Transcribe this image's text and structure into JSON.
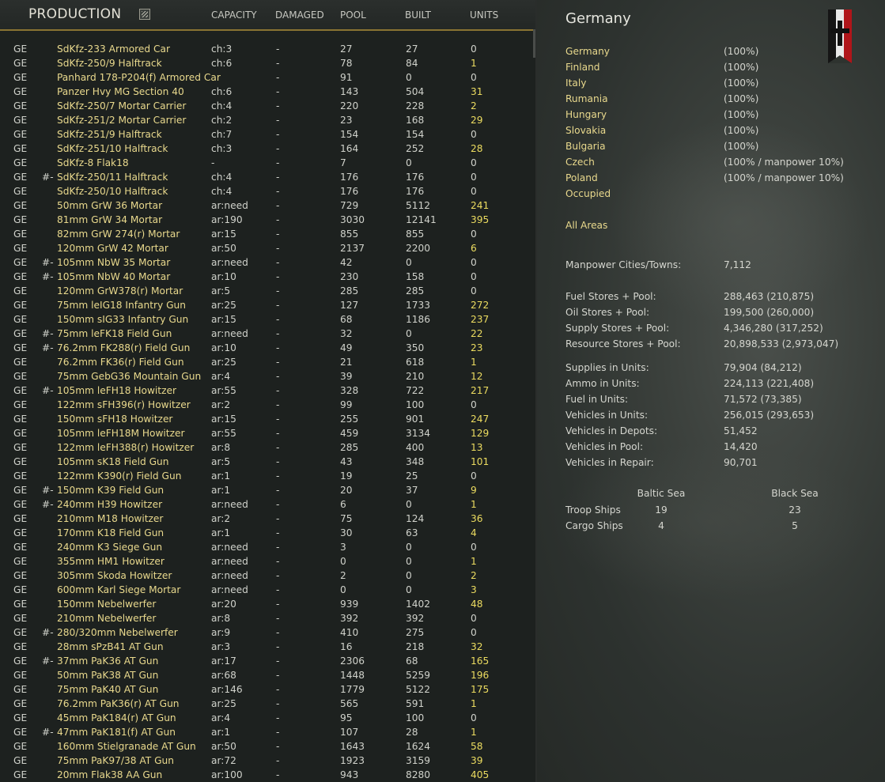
{
  "production": {
    "title": "PRODUCTION",
    "columns": [
      "CAPACITY",
      "DAMAGED",
      "POOL",
      "BUILT",
      "UNITS"
    ],
    "rows": [
      {
        "nat": "GE",
        "mark": "",
        "name": "SdKfz-233 Armored Car",
        "cap": "ch:3",
        "dmg": "-",
        "pool": "27",
        "built": "27",
        "units": "0"
      },
      {
        "nat": "GE",
        "mark": "",
        "name": "SdKfz-250/9 Halftrack",
        "cap": "ch:6",
        "dmg": "-",
        "pool": "78",
        "built": "84",
        "units": "1"
      },
      {
        "nat": "GE",
        "mark": "",
        "name": "Panhard 178-P204(f) Armored Car",
        "cap": "",
        "dmg": "-",
        "pool": "91",
        "built": "0",
        "units": "0"
      },
      {
        "nat": "GE",
        "mark": "",
        "name": "Panzer Hvy MG Section 40",
        "cap": "ch:6",
        "dmg": "-",
        "pool": "143",
        "built": "504",
        "units": "31"
      },
      {
        "nat": "GE",
        "mark": "",
        "name": "SdKfz-250/7 Mortar Carrier",
        "cap": "ch:4",
        "dmg": "-",
        "pool": "220",
        "built": "228",
        "units": "2"
      },
      {
        "nat": "GE",
        "mark": "",
        "name": "SdKfz-251/2 Mortar Carrier",
        "cap": "ch:2",
        "dmg": "-",
        "pool": "23",
        "built": "168",
        "units": "29"
      },
      {
        "nat": "GE",
        "mark": "",
        "name": "SdKfz-251/9 Halftrack",
        "cap": "ch:7",
        "dmg": "-",
        "pool": "154",
        "built": "154",
        "units": "0"
      },
      {
        "nat": "GE",
        "mark": "",
        "name": "SdKfz-251/10 Halftrack",
        "cap": "ch:3",
        "dmg": "-",
        "pool": "164",
        "built": "252",
        "units": "28"
      },
      {
        "nat": "GE",
        "mark": "",
        "name": "SdKfz-8 Flak18",
        "cap": "-",
        "dmg": "-",
        "pool": "7",
        "built": "0",
        "units": "0"
      },
      {
        "nat": "GE",
        "mark": "#-",
        "name": "SdKfz-250/11 Halftrack",
        "cap": "ch:4",
        "dmg": "-",
        "pool": "176",
        "built": "176",
        "units": "0"
      },
      {
        "nat": "GE",
        "mark": "",
        "name": "SdKfz-250/10 Halftrack",
        "cap": "ch:4",
        "dmg": "-",
        "pool": "176",
        "built": "176",
        "units": "0"
      },
      {
        "nat": "GE",
        "mark": "",
        "name": "50mm GrW 36 Mortar",
        "cap": "ar:need",
        "dmg": "-",
        "pool": "729",
        "built": "5112",
        "units": "241"
      },
      {
        "nat": "GE",
        "mark": "",
        "name": "81mm GrW 34 Mortar",
        "cap": "ar:190",
        "dmg": "-",
        "pool": "3030",
        "built": "12141",
        "units": "395"
      },
      {
        "nat": "GE",
        "mark": "",
        "name": "82mm GrW 274(r) Mortar",
        "cap": "ar:15",
        "dmg": "-",
        "pool": "855",
        "built": "855",
        "units": "0"
      },
      {
        "nat": "GE",
        "mark": "",
        "name": "120mm GrW 42 Mortar",
        "cap": "ar:50",
        "dmg": "-",
        "pool": "2137",
        "built": "2200",
        "units": "6"
      },
      {
        "nat": "GE",
        "mark": "#-",
        "name": "105mm NbW 35 Mortar",
        "cap": "ar:need",
        "dmg": "-",
        "pool": "42",
        "built": "0",
        "units": "0"
      },
      {
        "nat": "GE",
        "mark": "#-",
        "name": "105mm NbW 40 Mortar",
        "cap": "ar:10",
        "dmg": "-",
        "pool": "230",
        "built": "158",
        "units": "0"
      },
      {
        "nat": "GE",
        "mark": "",
        "name": "120mm GrW378(r) Mortar",
        "cap": "ar:5",
        "dmg": "-",
        "pool": "285",
        "built": "285",
        "units": "0"
      },
      {
        "nat": "GE",
        "mark": "",
        "name": "75mm leIG18 Infantry Gun",
        "cap": "ar:25",
        "dmg": "-",
        "pool": "127",
        "built": "1733",
        "units": "272"
      },
      {
        "nat": "GE",
        "mark": "",
        "name": "150mm sIG33 Infantry Gun",
        "cap": "ar:15",
        "dmg": "-",
        "pool": "68",
        "built": "1186",
        "units": "237"
      },
      {
        "nat": "GE",
        "mark": "#-",
        "name": "75mm leFK18 Field Gun",
        "cap": "ar:need",
        "dmg": "-",
        "pool": "32",
        "built": "0",
        "units": "22"
      },
      {
        "nat": "GE",
        "mark": "#-",
        "name": "76.2mm FK288(r) Field Gun",
        "cap": "ar:10",
        "dmg": "-",
        "pool": "49",
        "built": "350",
        "units": "23"
      },
      {
        "nat": "GE",
        "mark": "",
        "name": "76.2mm FK36(r) Field Gun",
        "cap": "ar:25",
        "dmg": "-",
        "pool": "21",
        "built": "618",
        "units": "1"
      },
      {
        "nat": "GE",
        "mark": "",
        "name": "75mm GebG36 Mountain Gun",
        "cap": "ar:4",
        "dmg": "-",
        "pool": "39",
        "built": "210",
        "units": "12"
      },
      {
        "nat": "GE",
        "mark": "#-",
        "name": "105mm leFH18 Howitzer",
        "cap": "ar:55",
        "dmg": "-",
        "pool": "328",
        "built": "722",
        "units": "217"
      },
      {
        "nat": "GE",
        "mark": "",
        "name": "122mm sFH396(r) Howitzer",
        "cap": "ar:2",
        "dmg": "-",
        "pool": "99",
        "built": "100",
        "units": "0"
      },
      {
        "nat": "GE",
        "mark": "",
        "name": "150mm sFH18 Howitzer",
        "cap": "ar:15",
        "dmg": "-",
        "pool": "255",
        "built": "901",
        "units": "247"
      },
      {
        "nat": "GE",
        "mark": "",
        "name": "105mm leFH18M Howitzer",
        "cap": "ar:55",
        "dmg": "-",
        "pool": "459",
        "built": "3134",
        "units": "129"
      },
      {
        "nat": "GE",
        "mark": "",
        "name": "122mm leFH388(r) Howitzer",
        "cap": "ar:8",
        "dmg": "-",
        "pool": "285",
        "built": "400",
        "units": "13"
      },
      {
        "nat": "GE",
        "mark": "",
        "name": "105mm sK18 Field Gun",
        "cap": "ar:5",
        "dmg": "-",
        "pool": "43",
        "built": "348",
        "units": "101"
      },
      {
        "nat": "GE",
        "mark": "",
        "name": "122mm K390(r) Field Gun",
        "cap": "ar:1",
        "dmg": "-",
        "pool": "19",
        "built": "25",
        "units": "0"
      },
      {
        "nat": "GE",
        "mark": "#-",
        "name": "150mm K39 Field Gun",
        "cap": "ar:1",
        "dmg": "-",
        "pool": "20",
        "built": "37",
        "units": "9"
      },
      {
        "nat": "GE",
        "mark": "#-",
        "name": "240mm H39 Howitzer",
        "cap": "ar:need",
        "dmg": "-",
        "pool": "6",
        "built": "0",
        "units": "1"
      },
      {
        "nat": "GE",
        "mark": "",
        "name": "210mm M18 Howitzer",
        "cap": "ar:2",
        "dmg": "-",
        "pool": "75",
        "built": "124",
        "units": "36"
      },
      {
        "nat": "GE",
        "mark": "",
        "name": "170mm K18 Field Gun",
        "cap": "ar:1",
        "dmg": "-",
        "pool": "30",
        "built": "63",
        "units": "4"
      },
      {
        "nat": "GE",
        "mark": "",
        "name": "240mm K3 Siege Gun",
        "cap": "ar:need",
        "dmg": "-",
        "pool": "3",
        "built": "0",
        "units": "0"
      },
      {
        "nat": "GE",
        "mark": "",
        "name": "355mm HM1 Howitzer",
        "cap": "ar:need",
        "dmg": "-",
        "pool": "0",
        "built": "0",
        "units": "1"
      },
      {
        "nat": "GE",
        "mark": "",
        "name": "305mm Skoda Howitzer",
        "cap": "ar:need",
        "dmg": "-",
        "pool": "2",
        "built": "0",
        "units": "2"
      },
      {
        "nat": "GE",
        "mark": "",
        "name": "600mm Karl Siege Mortar",
        "cap": "ar:need",
        "dmg": "-",
        "pool": "0",
        "built": "0",
        "units": "3"
      },
      {
        "nat": "GE",
        "mark": "",
        "name": "150mm Nebelwerfer",
        "cap": "ar:20",
        "dmg": "-",
        "pool": "939",
        "built": "1402",
        "units": "48"
      },
      {
        "nat": "GE",
        "mark": "",
        "name": "210mm Nebelwerfer",
        "cap": "ar:8",
        "dmg": "-",
        "pool": "392",
        "built": "392",
        "units": "0"
      },
      {
        "nat": "GE",
        "mark": "#-",
        "name": "280/320mm Nebelwerfer",
        "cap": "ar:9",
        "dmg": "-",
        "pool": "410",
        "built": "275",
        "units": "0"
      },
      {
        "nat": "GE",
        "mark": "",
        "name": "28mm sPzB41 AT Gun",
        "cap": "ar:3",
        "dmg": "-",
        "pool": "16",
        "built": "218",
        "units": "32"
      },
      {
        "nat": "GE",
        "mark": "#-",
        "name": "37mm PaK36 AT Gun",
        "cap": "ar:17",
        "dmg": "-",
        "pool": "2306",
        "built": "68",
        "units": "165"
      },
      {
        "nat": "GE",
        "mark": "",
        "name": "50mm PaK38 AT Gun",
        "cap": "ar:68",
        "dmg": "-",
        "pool": "1448",
        "built": "5259",
        "units": "196"
      },
      {
        "nat": "GE",
        "mark": "",
        "name": "75mm PaK40 AT Gun",
        "cap": "ar:146",
        "dmg": "-",
        "pool": "1779",
        "built": "5122",
        "units": "175"
      },
      {
        "nat": "GE",
        "mark": "",
        "name": "76.2mm PaK36(r) AT Gun",
        "cap": "ar:25",
        "dmg": "-",
        "pool": "565",
        "built": "591",
        "units": "1"
      },
      {
        "nat": "GE",
        "mark": "",
        "name": "45mm PaK184(r) AT Gun",
        "cap": "ar:4",
        "dmg": "-",
        "pool": "95",
        "built": "100",
        "units": "0"
      },
      {
        "nat": "GE",
        "mark": "#-",
        "name": "47mm PaK181(f) AT Gun",
        "cap": "ar:1",
        "dmg": "-",
        "pool": "107",
        "built": "28",
        "units": "1"
      },
      {
        "nat": "GE",
        "mark": "",
        "name": "160mm Stielgranade AT Gun",
        "cap": "ar:50",
        "dmg": "-",
        "pool": "1643",
        "built": "1624",
        "units": "58"
      },
      {
        "nat": "GE",
        "mark": "",
        "name": "75mm PaK97/38 AT Gun",
        "cap": "ar:72",
        "dmg": "-",
        "pool": "1923",
        "built": "3159",
        "units": "39"
      },
      {
        "nat": "GE",
        "mark": "",
        "name": "20mm Flak38 AA Gun",
        "cap": "ar:100",
        "dmg": "-",
        "pool": "943",
        "built": "8280",
        "units": "405"
      }
    ]
  },
  "country": {
    "title": "Germany",
    "areas": [
      {
        "name": "Germany",
        "value": "(100%)"
      },
      {
        "name": "Finland",
        "value": "(100%)"
      },
      {
        "name": "Italy",
        "value": "(100%)"
      },
      {
        "name": "Rumania",
        "value": "(100%)"
      },
      {
        "name": "Hungary",
        "value": "(100%)"
      },
      {
        "name": "Slovakia",
        "value": "(100%)"
      },
      {
        "name": "Bulgaria",
        "value": "(100%)"
      },
      {
        "name": "Czech",
        "value": "(100% / manpower 10%)"
      },
      {
        "name": "Poland",
        "value": "(100% / manpower 10%)"
      },
      {
        "name": "Occupied",
        "value": ""
      }
    ],
    "all_areas": "All Areas",
    "manpower": {
      "label": "Manpower Cities/Towns:",
      "value": "7,112"
    },
    "stores": [
      {
        "label": "Fuel Stores + Pool:",
        "value": "288,463 (210,875)"
      },
      {
        "label": "Oil Stores + Pool:",
        "value": "199,500 (260,000)"
      },
      {
        "label": "Supply Stores + Pool:",
        "value": "4,346,280 (317,252)"
      },
      {
        "label": "Resource Stores + Pool:",
        "value": "20,898,533 (2,973,047)"
      }
    ],
    "units": [
      {
        "label": "Supplies in Units:",
        "value": "79,904 (84,212)"
      },
      {
        "label": "Ammo in Units:",
        "value": "224,113 (221,408)"
      },
      {
        "label": "Fuel in Units:",
        "value": "71,572 (73,385)"
      },
      {
        "label": "Vehicles in Units:",
        "value": "256,015 (293,653)"
      },
      {
        "label": "Vehicles in Depots:",
        "value": "51,452"
      },
      {
        "label": "Vehicles in Pool:",
        "value": "14,420"
      },
      {
        "label": "Vehicles in Repair:",
        "value": "90,701"
      }
    ],
    "ships": {
      "seas": [
        "Baltic Sea",
        "Black Sea"
      ],
      "rows": [
        {
          "label": "Troop Ships",
          "values": [
            "19",
            "23"
          ]
        },
        {
          "label": "Cargo Ships",
          "values": [
            "4",
            "5"
          ]
        }
      ]
    }
  },
  "colors": {
    "accent": "#e9d98d",
    "highlight": "#ecdc60",
    "header_border": "#8a7433"
  },
  "icons": {
    "production": "report-icon",
    "flag": "german-flag-icon"
  }
}
